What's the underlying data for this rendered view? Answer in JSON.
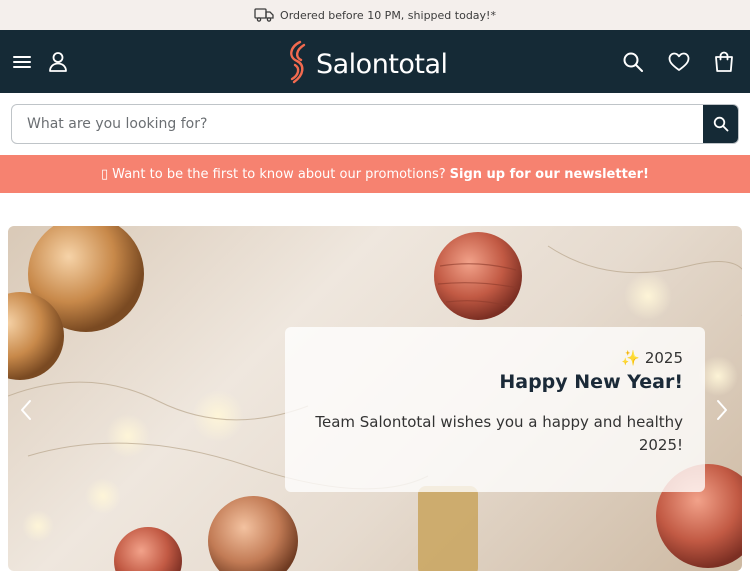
{
  "topbar": {
    "icon": "truck-icon",
    "text": "Ordered before 10 PM, shipped today!*"
  },
  "header": {
    "logo_text": "Salontotal",
    "logo_icon": "salontotal-logo-mark",
    "left_icons": [
      "menu-icon",
      "user-icon"
    ],
    "right_icons": [
      "search-icon",
      "heart-icon",
      "bag-icon"
    ]
  },
  "search": {
    "placeholder": "What are you looking for?"
  },
  "promo": {
    "icon_glyph": "▯",
    "text": "Want to be the first to know about our promotions?",
    "link": "Sign up for our newsletter!"
  },
  "hero": {
    "year": "✨ 2025",
    "title": "Happy New Year!",
    "message": "Team Salontotal wishes you a happy and healthy 2025!"
  },
  "colors": {
    "header_bg": "#152a36",
    "topbar_bg": "#f4efec",
    "promo_bg": "#f68270",
    "logo_accent": "#f26a4f"
  }
}
